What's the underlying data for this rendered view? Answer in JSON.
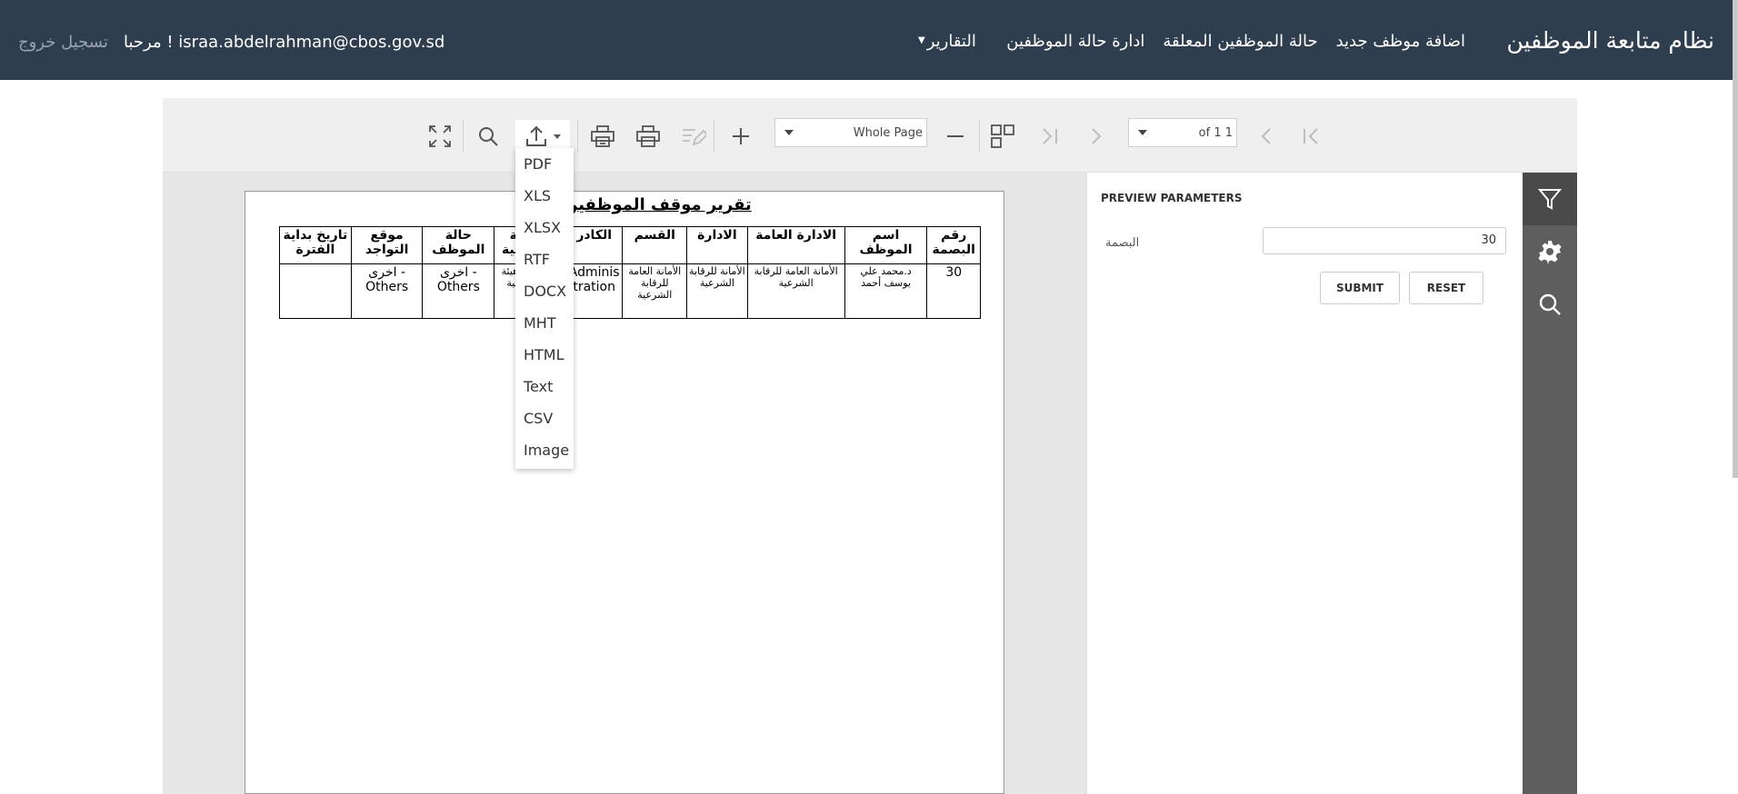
{
  "navbar": {
    "brand": "نظام متابعة الموظفين",
    "links": [
      "اضافة موظف جديد",
      "حالة الموظفين المعلقة",
      "ادارة حالة الموظفين"
    ],
    "reports": "التقارير",
    "welcome": "مرحبا ! israa.abdelrahman@cbos.gov.sd",
    "logout": "تسجيل خروج"
  },
  "toolbar": {
    "zoom_select": "Whole Page",
    "page_of": "of 1 1",
    "icons": [
      "fullscreen-icon",
      "search-icon",
      "export-icon",
      "print-page-icon",
      "print-icon",
      "edit-icon",
      "zoom-in-icon",
      "zoom-out-icon",
      "multipage-icon",
      "last-page-icon",
      "next-page-icon",
      "prev-page-icon",
      "first-page-icon"
    ]
  },
  "export_menu": [
    "PDF",
    "XLS",
    "XLSX",
    "RTF",
    "DOCX",
    "MHT",
    "HTML",
    "Text",
    "CSV",
    "Image"
  ],
  "report": {
    "title": "تقرير موقف الموظفين",
    "headers": [
      "رقم البصمة",
      "اسم الموظف",
      "الادارة العامة",
      "الادارة",
      "القسم",
      "الكادر",
      "الدرجة الوظيفية",
      "حالة الموظف",
      "موقع التواجد",
      "تاريخ بداية الفترة"
    ],
    "row": [
      "30",
      "د.محمد علي يوسف أحمد",
      "الأمانة العامة للرقابة الشرعية",
      "الأمانة للرقابة الشرعية",
      "الأمانة العامة للرقابة الشرعية",
      "Administration",
      "مدير عام هيئة عليا شرعية",
      "- اخرى Others",
      "- اخرى Others",
      ""
    ]
  },
  "params": {
    "title": "PREVIEW PARAMETERS",
    "label": "البصمة",
    "value": "30",
    "submit": "SUBMIT",
    "reset": "RESET"
  },
  "side_tabs": [
    "filter-icon",
    "gear-icon",
    "search-icon"
  ]
}
